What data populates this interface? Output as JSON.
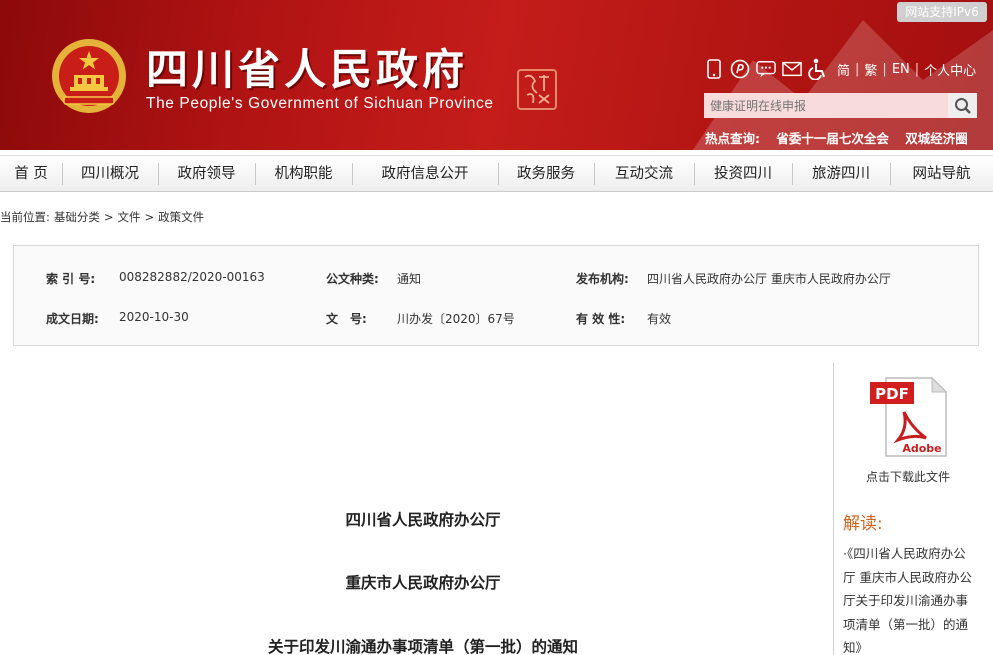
{
  "header": {
    "title": "四川省人民政府",
    "subtitle": "The People's Government of Sichuan Province",
    "ipv6_badge": "网站支持IPv6",
    "toolbar": {
      "icons": [
        "mobile-icon",
        "weibo-icon",
        "wechat-icon",
        "mail-icon",
        "accessibility-icon"
      ],
      "links": [
        "简",
        "繁",
        "EN",
        "个人中心"
      ]
    },
    "search": {
      "placeholder": "健康证明在线申报"
    },
    "hot": {
      "label": "热点查询:",
      "items": [
        "省委十一届七次全会",
        "双城经济圈"
      ]
    }
  },
  "nav": [
    "首 页",
    "四川概况",
    "政府领导",
    "机构职能",
    "政府信息公开",
    "政务服务",
    "互动交流",
    "投资四川",
    "旅游四川",
    "网站导航"
  ],
  "breadcrumb": {
    "prefix": "当前位置:",
    "items": [
      "基础分类",
      "文件",
      "政策文件"
    ],
    "sep": ">"
  },
  "meta": {
    "index_label": "索 引 号:",
    "index_value": "008282882/2020-00163",
    "type_label": "公文种类:",
    "type_value": "通知",
    "publisher_label": "发布机构:",
    "publisher_value": "四川省人民政府办公厅 重庆市人民政府办公厅",
    "date_label": "成文日期:",
    "date_value": "2020-10-30",
    "docno_label": "文　号:",
    "docno_value": "川办发〔2020〕67号",
    "valid_label": "有 效 性:",
    "valid_value": "有效"
  },
  "document": {
    "line1": "四川省人民政府办公厅",
    "line2": "重庆市人民政府办公厅",
    "line3": "关于印发川渝通办事项清单（第一批）的通知"
  },
  "sidebar": {
    "download": "点击下载此文件",
    "interpret_title": "解读:",
    "interpret_link": "·《四川省人民政府办公厅 重庆市人民政府办公厅关于印发川渝通办事项清单（第一批）的通知》"
  },
  "colors": {
    "header_red": "#b01313",
    "orange": "#d1641f"
  }
}
